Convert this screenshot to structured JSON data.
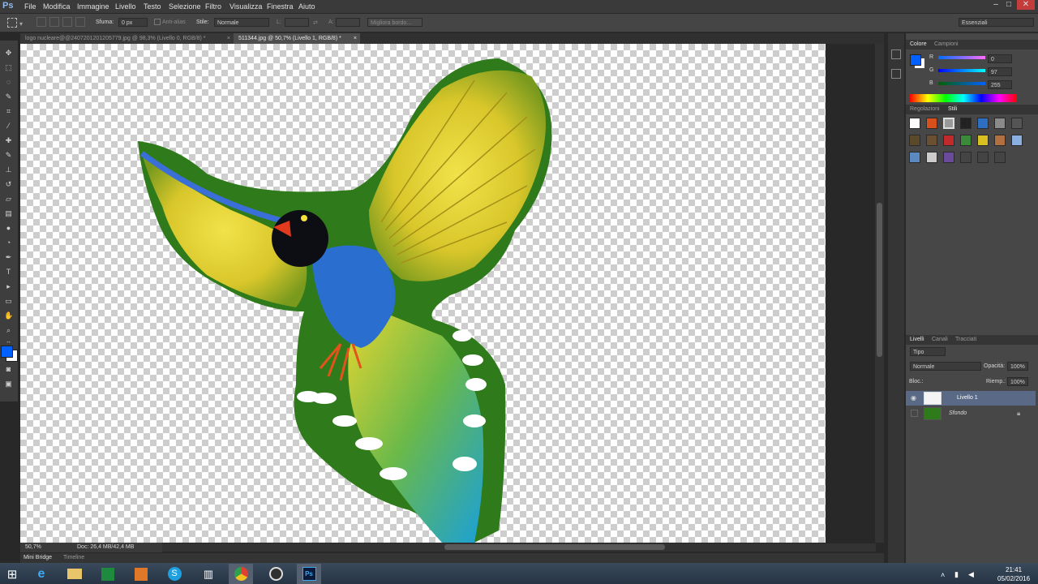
{
  "app": {
    "logo": "Ps"
  },
  "menu": [
    "File",
    "Modifica",
    "Immagine",
    "Livello",
    "Testo",
    "Selezione",
    "Filtro",
    "Visualizza",
    "Finestra",
    "Aiuto"
  ],
  "window_controls": {
    "minimize": "–",
    "maximize": "□",
    "close": "✕"
  },
  "options": {
    "sfuma_label": "Sfuma:",
    "sfuma_value": "0 px",
    "antialias_label": "Anti-alias",
    "stile_label": "Stile:",
    "stile_value": "Normale",
    "width_label": "L:",
    "height_label": "A:",
    "refine_button": "Migliora bordo...",
    "workspace": "Essenziali"
  },
  "tabs": [
    {
      "label": "logo nucleare@@2407201201205779.jpg @ 98,3% (Livello 0, RGB/8) *",
      "close": "×"
    },
    {
      "label": "511344.jpg @ 50,7% (Livello 1, RGB/8) *",
      "close": "×"
    }
  ],
  "status": {
    "zoom": "50,7%",
    "doc": "Doc: 26,4 MB/42,4 MB"
  },
  "bottom_tabs": [
    "Mini Bridge",
    "Timeline"
  ],
  "color_panel": {
    "tabs": [
      "Colore",
      "Campioni"
    ],
    "r_label": "R",
    "g_label": "G",
    "b_label": "B",
    "r": "0",
    "g": "97",
    "b": "255",
    "fg_color": "#0061ff"
  },
  "styles_panel": {
    "tabs": [
      "Regolazioni",
      "Stili"
    ]
  },
  "layers_panel": {
    "tabs": [
      "Livelli",
      "Canali",
      "Tracciati"
    ],
    "filter": "Tipo",
    "blend": "Normale",
    "opacity_label": "Opacità:",
    "opacity": "100%",
    "lock_label": "Bloc.:",
    "fill_label": "Riemp.:",
    "fill": "100%",
    "layers": [
      {
        "name": "Livello 1",
        "visible": true,
        "selected": true
      },
      {
        "name": "Sfondo",
        "visible": false,
        "selected": false,
        "locked": true
      }
    ]
  },
  "taskbar": {
    "apps": [
      "windows-start",
      "internet-explorer",
      "file-explorer",
      "excel",
      "outlook",
      "skype",
      "audio-app",
      "chrome",
      "obs",
      "photoshop"
    ],
    "clock": "21:41",
    "date": "05/02/2016"
  }
}
